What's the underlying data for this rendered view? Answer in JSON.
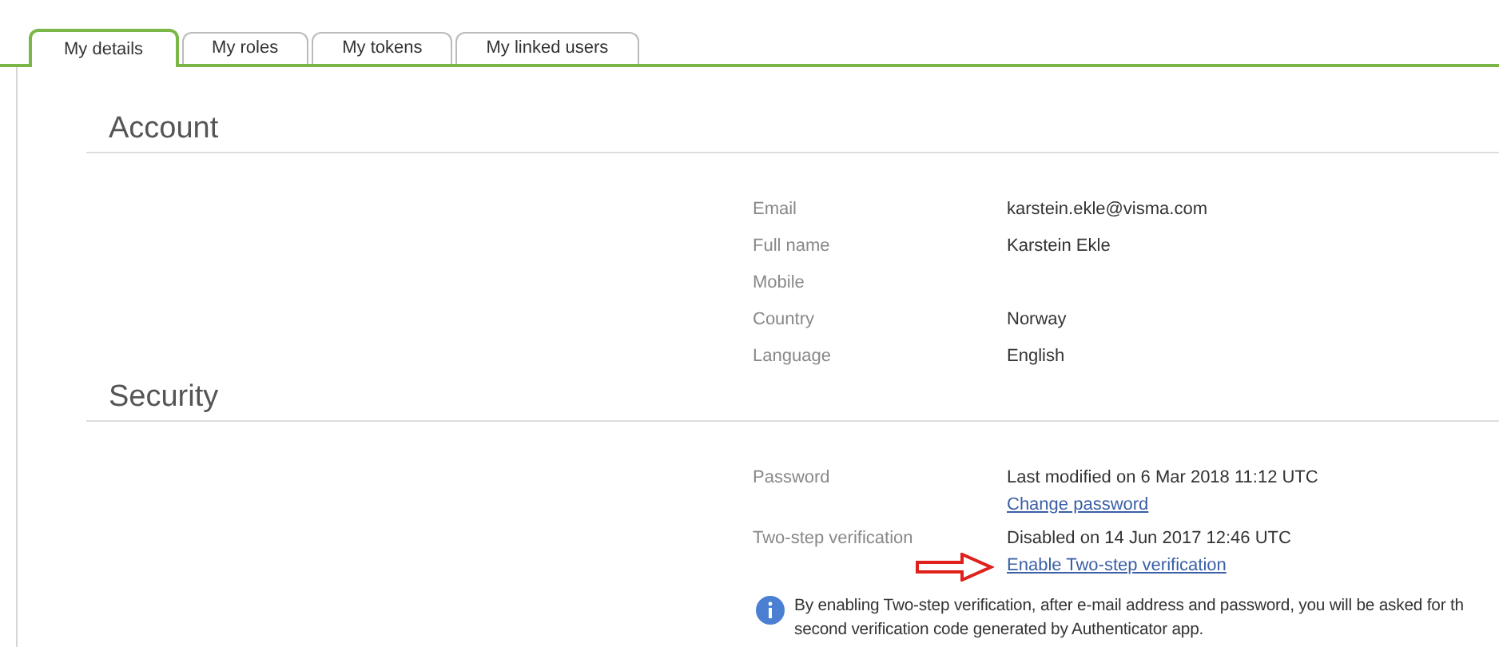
{
  "tabs": [
    {
      "label": "My details",
      "selected": true
    },
    {
      "label": "My roles",
      "selected": false
    },
    {
      "label": "My tokens",
      "selected": false
    },
    {
      "label": "My linked users",
      "selected": false
    }
  ],
  "sections": [
    {
      "title": "Account",
      "rows": [
        {
          "label": "Email",
          "values": [
            {
              "kind": "text",
              "text": "karstein.ekle@visma.com"
            }
          ]
        },
        {
          "label": "Full name",
          "values": [
            {
              "kind": "text",
              "text": "Karstein Ekle"
            }
          ]
        },
        {
          "label": "Mobile",
          "values": []
        },
        {
          "label": "Country",
          "values": [
            {
              "kind": "text",
              "text": "Norway"
            }
          ]
        },
        {
          "label": "Language",
          "values": [
            {
              "kind": "text",
              "text": "English"
            }
          ]
        }
      ]
    },
    {
      "title": "Security",
      "rows": [
        {
          "label": "Password",
          "values": [
            {
              "kind": "text",
              "text": "Last modified on 6 Mar 2018 11:12 UTC"
            },
            {
              "kind": "link",
              "text": "Change password"
            }
          ]
        },
        {
          "label": "Two-step verification",
          "values": [
            {
              "kind": "text",
              "text": "Disabled on 14 Jun 2017 12:46 UTC"
            },
            {
              "kind": "link",
              "text": "Enable Two-step verification",
              "highlighted": true
            }
          ]
        }
      ],
      "info": {
        "lines": [
          "By enabling Two-step verification, after e-mail address and password, you will be asked for th",
          "second verification code generated by Authenticator app."
        ]
      }
    }
  ]
}
